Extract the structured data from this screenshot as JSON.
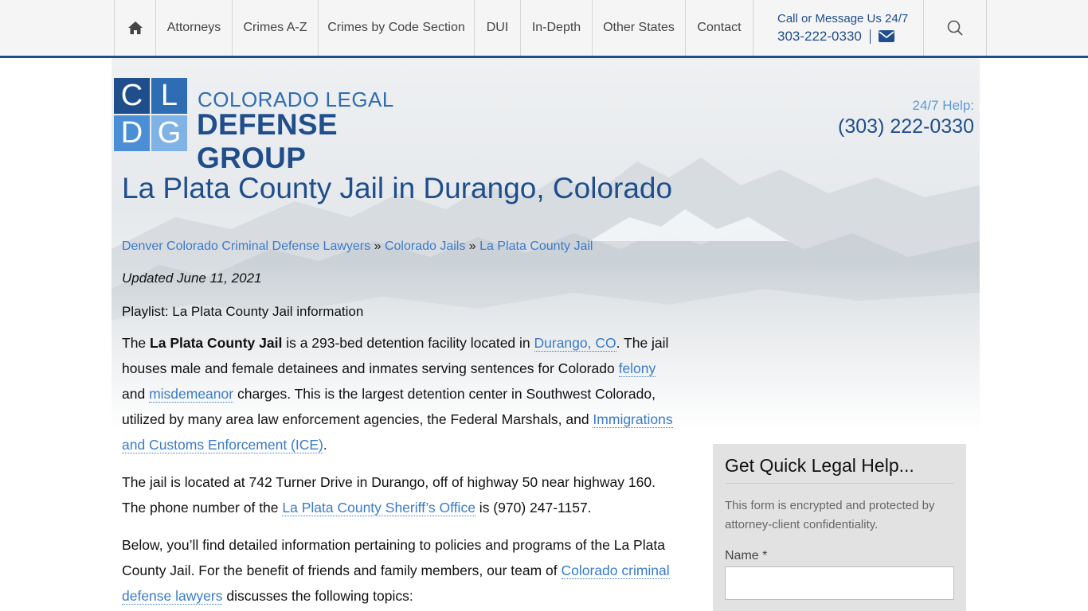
{
  "nav": {
    "home_icon": "home-icon",
    "items": [
      "Attorneys",
      "Crimes A-Z",
      "Crimes by Code Section",
      "DUI",
      "In-Depth",
      "Other States",
      "Contact"
    ],
    "call_label": "Call or Message Us 24/7",
    "call_phone": "303-222-0330",
    "mail_icon": "envelope-icon",
    "search_icon": "search-icon"
  },
  "logo": {
    "letters": [
      "C",
      "L",
      "D",
      "G"
    ],
    "line1": "COLORADO LEGAL",
    "line2": "DEFENSE GROUP"
  },
  "help": {
    "label": "24/7 Help:",
    "phone": "(303) 222-0330"
  },
  "page": {
    "title": "La Plata County Jail in Durango, Colorado",
    "breadcrumb": {
      "items": [
        "Denver Colorado Criminal Defense Lawyers",
        "Colorado Jails",
        "La Plata County Jail"
      ],
      "separator": "»"
    },
    "updated": "Updated June 11, 2021",
    "playlist": "Playlist: La Plata County Jail information",
    "p1": {
      "t1": "The ",
      "bold": "La Plata County Jail",
      "t2": " is a 293-bed detention facility located in ",
      "link1": "Durango, CO",
      "t3": ". The jail houses male and female detainees and inmates serving sentences for Colorado ",
      "link2": "felony",
      "t4": " and ",
      "link3": "misdemeanor",
      "t5": " charges. This is the largest detention center in Southwest Colorado, utilized by many area law enforcement agencies, the Federal Marshals, and ",
      "link4": "Immigrations and Customs Enforcement (ICE)",
      "t6": "."
    },
    "p2": {
      "t1": "The jail is located at 742 Turner Drive in Durango, off of highway 50 near highway 160. The phone number of the ",
      "link1": "La Plata County Sheriff’s Office",
      "t2": " is (970) 247-1157."
    },
    "p3": {
      "t1": "Below, you’ll find detailed information pertaining to policies and programs of the La Plata County Jail. For the benefit of friends and family members, our team of ",
      "link1": "Colorado criminal defense lawyers",
      "t2": " discusses the following topics:"
    }
  },
  "form": {
    "title": "Get Quick Legal Help...",
    "note": "This form is encrypted and protected by attorney-client confidentiality.",
    "name_label": "Name *",
    "name_value": ""
  },
  "colors": {
    "brand_dark": "#1f4e8c",
    "brand_mid": "#2e6db4",
    "link": "#3a7bc8"
  }
}
